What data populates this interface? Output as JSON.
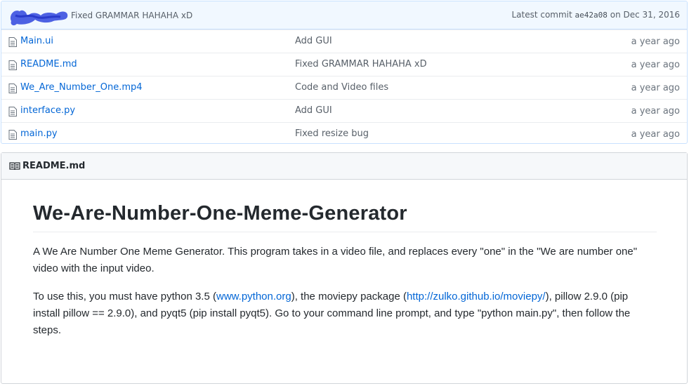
{
  "commit_bar": {
    "message": "Fixed GRAMMAR HAHAHA xD",
    "latest_label": "Latest commit",
    "sha": "ae42a08",
    "on_label": "on",
    "date": "Dec 31, 2016"
  },
  "files": [
    {
      "name": "Main.ui",
      "message": "Add GUI",
      "age": "a year ago"
    },
    {
      "name": "README.md",
      "message": "Fixed GRAMMAR HAHAHA xD",
      "age": "a year ago"
    },
    {
      "name": "We_Are_Number_One.mp4",
      "message": "Code and Video files",
      "age": "a year ago"
    },
    {
      "name": "interface.py",
      "message": "Add GUI",
      "age": "a year ago"
    },
    {
      "name": "main.py",
      "message": "Fixed resize bug",
      "age": "a year ago"
    }
  ],
  "readme": {
    "header": "README.md",
    "title": "We-Are-Number-One-Meme-Generator",
    "p1": "A We Are Number One Meme Generator. This program takes in a video file, and replaces every \"one\" in the \"We are number one\" video with the input video.",
    "p2_a": "To use this, you must have python 3.5 (",
    "p2_link1": "www.python.org",
    "p2_b": "), the moviepy package (",
    "p2_link2": "http://zulko.github.io/moviepy/",
    "p2_c": "), pillow 2.9.0 (pip install pillow == 2.9.0), and pyqt5 (pip install pyqt5). Go to your command line prompt, and type \"python main.py\", then follow the steps."
  },
  "colors": {
    "link": "#0366d6",
    "commit_bg": "#f1f8ff",
    "scribble": "#3b50e0"
  }
}
